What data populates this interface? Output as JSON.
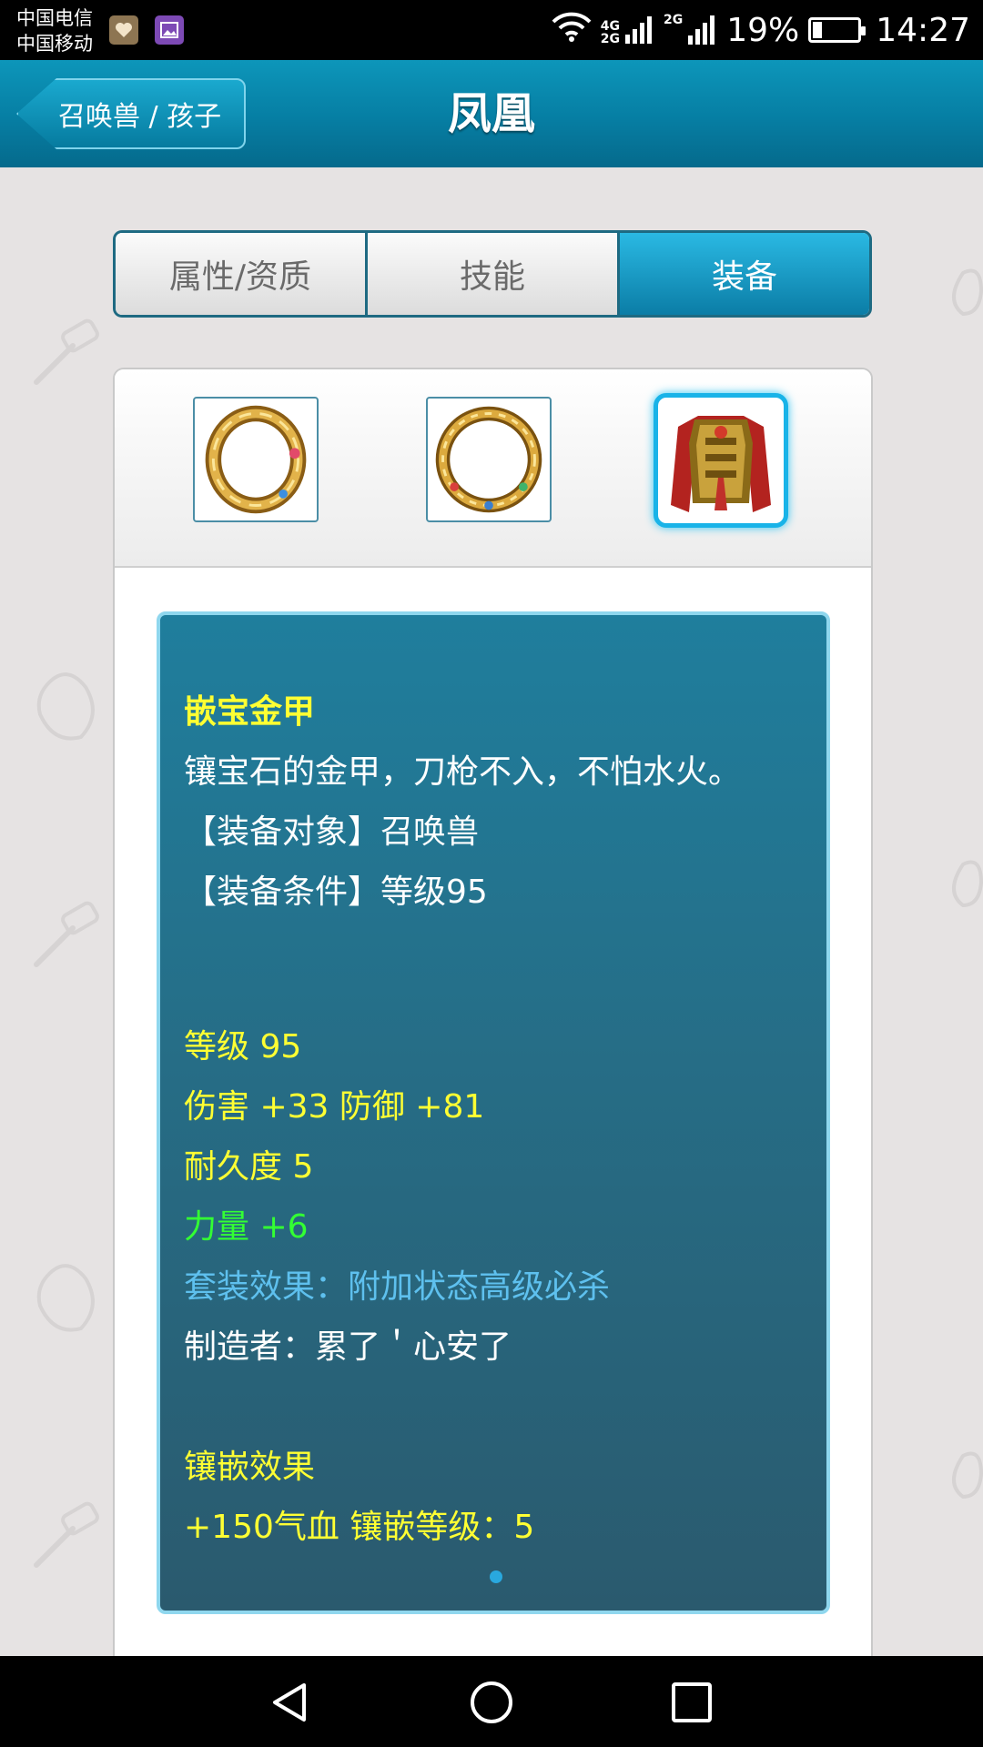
{
  "status_bar": {
    "carrier_1": "中国电信",
    "carrier_2": "中国移动",
    "net_1": "4G",
    "net_2": "2G",
    "net_3": "2G",
    "battery_percent": "19%",
    "battery_level": 0.19,
    "time": "14:27"
  },
  "header": {
    "back_label": "召唤兽 / 孩子",
    "title": "凤凰"
  },
  "tabs": [
    {
      "label": "属性/资质",
      "active": false
    },
    {
      "label": "技能",
      "active": false
    },
    {
      "label": "装备",
      "active": true
    }
  ],
  "equipment_slots": [
    {
      "name": "ring-1",
      "icon": "gold-ring-icon",
      "selected": false
    },
    {
      "name": "ring-2",
      "icon": "gold-necklace-icon",
      "selected": false
    },
    {
      "name": "armor",
      "icon": "golden-armor-icon",
      "selected": true
    }
  ],
  "item": {
    "name": "嵌宝金甲",
    "description": "镶宝石的金甲，刀枪不入，不怕水火。",
    "target": "【装备对象】召唤兽",
    "requirement": "【装备条件】等级95",
    "level": "等级 95",
    "attack_defense": "伤害 +33 防御 +81",
    "durability": "耐久度 5",
    "strength": "力量 +6",
    "set_effect": "套装效果：附加状态高级必杀",
    "maker": "制造者：累了＇心安了",
    "inlay_title": "镶嵌效果",
    "inlay_detail": "+150气血 镶嵌等级：5"
  },
  "colors": {
    "header_blue": "#067ea3",
    "active_tab": "#0b7da6",
    "info_bg": "#266d86",
    "item_yellow": "#ffff33",
    "stat_green": "#33ff33",
    "set_blue": "#5ec0ee"
  }
}
